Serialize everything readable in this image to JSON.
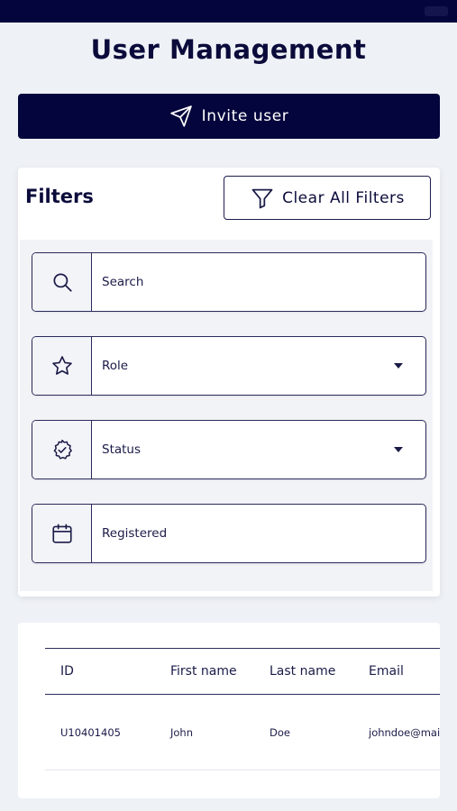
{
  "header": {
    "title": "User Management"
  },
  "invite": {
    "label": "Invite user"
  },
  "filters": {
    "title": "Filters",
    "clear_label": "Clear All Filters",
    "fields": [
      {
        "label": "Search",
        "icon": "search-icon"
      },
      {
        "label": "Role",
        "icon": "star-icon",
        "dropdown": true
      },
      {
        "label": "Status",
        "icon": "badge-check-icon",
        "dropdown": true
      },
      {
        "label": "Registered",
        "icon": "calendar-icon"
      }
    ]
  },
  "table": {
    "columns": [
      "ID",
      "First name",
      "Last name",
      "Email"
    ],
    "rows": [
      {
        "id": "U10401405",
        "first": "John",
        "last": "Doe",
        "email": "johndoe@mai"
      }
    ]
  },
  "colors": {
    "primary": "#05053d",
    "text": "#0b0b3b",
    "background": "#eef1f6"
  }
}
